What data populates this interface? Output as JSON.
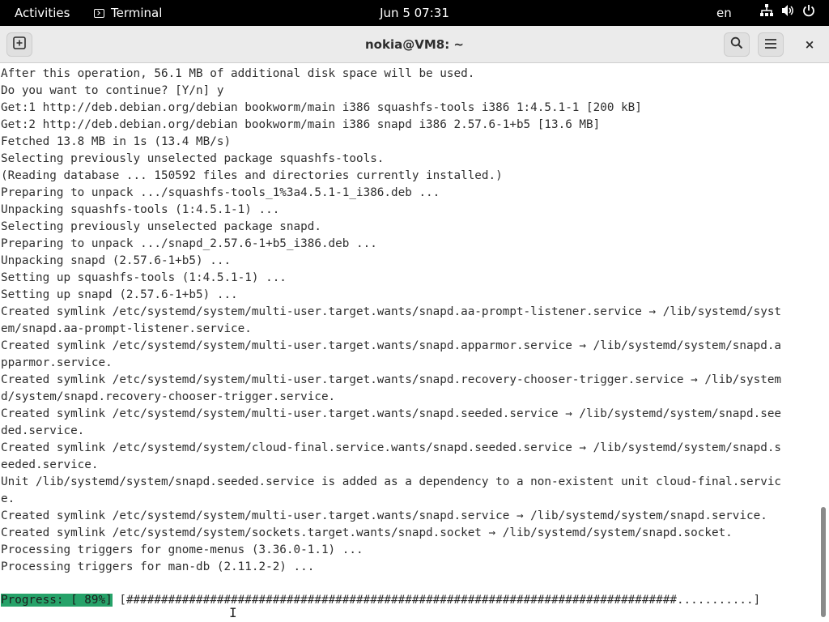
{
  "topbar": {
    "activities": "Activities",
    "app_name": "Terminal",
    "clock": "Jun 5  07:31",
    "language": "en",
    "icons": [
      "network-icon",
      "volume-icon",
      "power-icon"
    ]
  },
  "window": {
    "title": "nokia@VM8: ~",
    "new_tab_icon": "new-tab-icon",
    "search_icon": "search-icon",
    "menu_icon": "hamburger-menu-icon",
    "close_label": "×"
  },
  "terminal": {
    "lines": [
      "After this operation, 56.1 MB of additional disk space will be used.",
      "Do you want to continue? [Y/n] y",
      "Get:1 http://deb.debian.org/debian bookworm/main i386 squashfs-tools i386 1:4.5.1-1 [200 kB]",
      "Get:2 http://deb.debian.org/debian bookworm/main i386 snapd i386 2.57.6-1+b5 [13.6 MB]",
      "Fetched 13.8 MB in 1s (13.4 MB/s)",
      "Selecting previously unselected package squashfs-tools.",
      "(Reading database ... 150592 files and directories currently installed.)",
      "Preparing to unpack .../squashfs-tools_1%3a4.5.1-1_i386.deb ...",
      "Unpacking squashfs-tools (1:4.5.1-1) ...",
      "Selecting previously unselected package snapd.",
      "Preparing to unpack .../snapd_2.57.6-1+b5_i386.deb ...",
      "Unpacking snapd (2.57.6-1+b5) ...",
      "Setting up squashfs-tools (1:4.5.1-1) ...",
      "Setting up snapd (2.57.6-1+b5) ...",
      "Created symlink /etc/systemd/system/multi-user.target.wants/snapd.aa-prompt-listener.service → /lib/systemd/syst",
      "em/snapd.aa-prompt-listener.service.",
      "Created symlink /etc/systemd/system/multi-user.target.wants/snapd.apparmor.service → /lib/systemd/system/snapd.a",
      "pparmor.service.",
      "Created symlink /etc/systemd/system/multi-user.target.wants/snapd.recovery-chooser-trigger.service → /lib/system",
      "d/system/snapd.recovery-chooser-trigger.service.",
      "Created symlink /etc/systemd/system/multi-user.target.wants/snapd.seeded.service → /lib/systemd/system/snapd.see",
      "ded.service.",
      "Created symlink /etc/systemd/system/cloud-final.service.wants/snapd.seeded.service → /lib/systemd/system/snapd.s",
      "eeded.service.",
      "Unit /lib/systemd/system/snapd.seeded.service is added as a dependency to a non-existent unit cloud-final.servic",
      "e.",
      "Created symlink /etc/systemd/system/multi-user.target.wants/snapd.service → /lib/systemd/system/snapd.service.",
      "Created symlink /etc/systemd/system/sockets.target.wants/snapd.socket → /lib/systemd/system/snapd.socket.",
      "Processing triggers for gnome-menus (3.36.0-1.1) ...",
      "Processing triggers for man-db (2.11.2-2) ...",
      ""
    ],
    "progress": {
      "label": "Progress: [ 89%]",
      "bar": " [###############################################################################...........]",
      "percent": 89
    }
  },
  "colors": {
    "topbar_bg": "#000000",
    "headerbar_bg": "#ebebeb",
    "progress_bg": "#26a269",
    "text": "#2e2e2e"
  }
}
